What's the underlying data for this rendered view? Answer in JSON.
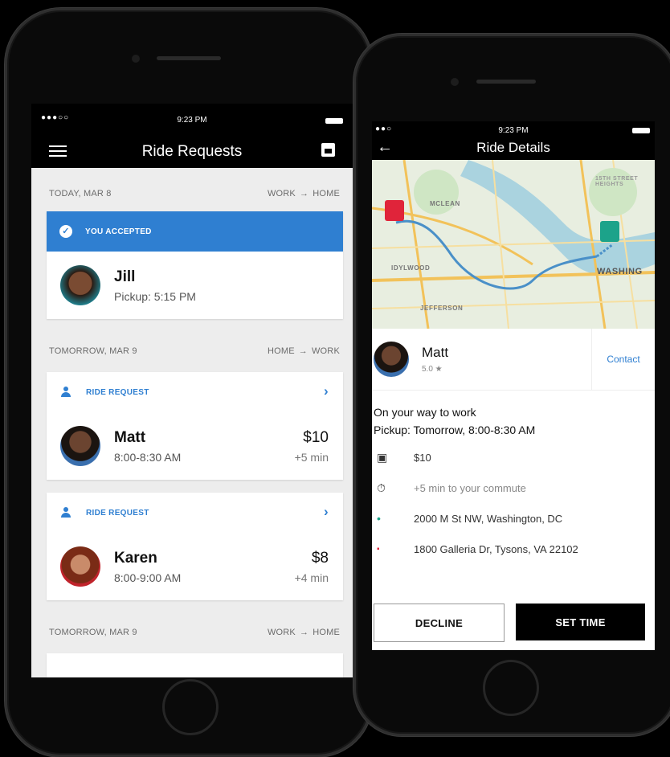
{
  "left_screen": {
    "status_time": "9:23 PM",
    "title": "Ride Requests",
    "sections": [
      {
        "date": "TODAY, MAR 8",
        "from": "WORK",
        "to": "HOME"
      },
      {
        "date": "TOMORROW, MAR 9",
        "from": "HOME",
        "to": "WORK"
      },
      {
        "date": "TOMORROW, MAR 9",
        "from": "WORK",
        "to": "HOME"
      }
    ],
    "accepted": {
      "banner": "YOU ACCEPTED",
      "name": "Jill",
      "pickup": "Pickup: 5:15 PM"
    },
    "requests": [
      {
        "label": "RIDE REQUEST",
        "name": "Matt",
        "time": "8:00-8:30 AM",
        "price": "$10",
        "extra": "+5 min"
      },
      {
        "label": "RIDE REQUEST",
        "name": "Karen",
        "time": "8:00-9:00 AM",
        "price": "$8",
        "extra": "+4 min"
      }
    ]
  },
  "right_screen": {
    "status_time": "9:23 PM",
    "title": "Ride Details",
    "map_labels": {
      "mclean": "MCLEAN",
      "idylwood": "IDYLWOOD",
      "jefferson": "JEFFERSON",
      "washington": "WASHING",
      "heights": "15TH STREET HEIGHTS"
    },
    "driver": {
      "name": "Matt",
      "rating": "5.0 ★",
      "contact": "Contact"
    },
    "trip_line1": "On your way to work",
    "trip_line2": "Pickup: Tomorrow, 8:00-8:30 AM",
    "fare": "$10",
    "commute": "+5 min to your commute",
    "origin": "2000 M St NW, Washington, DC",
    "destination": "1800 Galleria Dr, Tysons, VA 22102",
    "decline_label": "DECLINE",
    "set_time_label": "SET TIME"
  },
  "colors": {
    "accent": "#2f7fd1",
    "pin_red": "#e0243a",
    "pin_green": "#1ca38a"
  }
}
